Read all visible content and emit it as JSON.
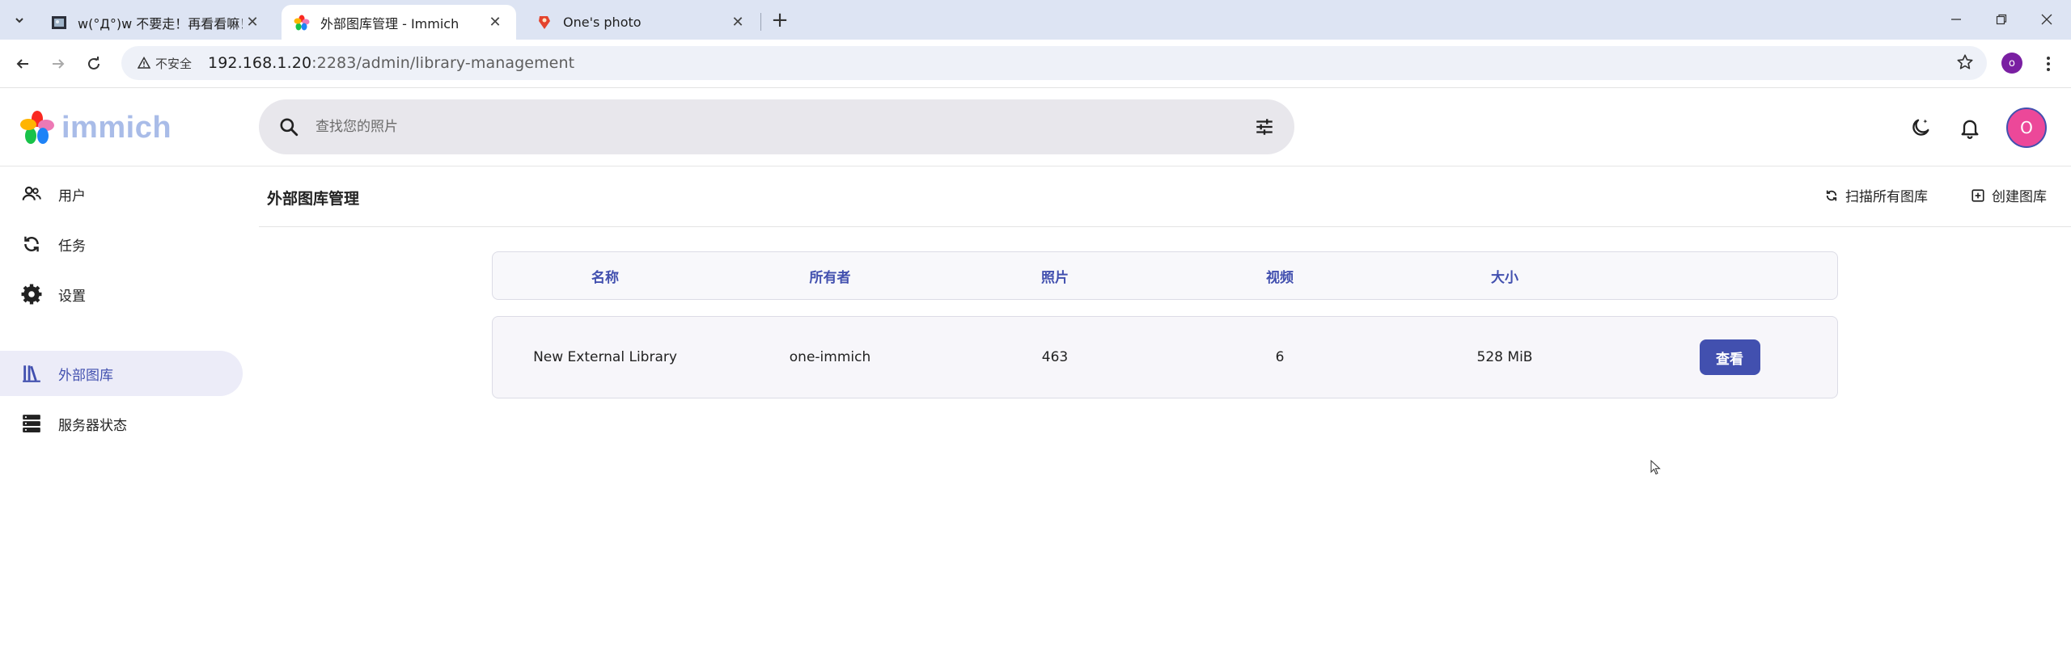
{
  "browser": {
    "tabs": [
      {
        "title": "w(°Д°)w 不要走！再看看嘛！",
        "active": false
      },
      {
        "title": "外部图库管理 - Immich",
        "active": true
      },
      {
        "title": "One's photo",
        "active": false
      }
    ],
    "security_label": "不安全",
    "url_host": "192.168.1.20",
    "url_path": ":2283/admin/library-management",
    "profile_initial": "o"
  },
  "app": {
    "logo_text": "immich",
    "search_placeholder": "查找您的照片",
    "avatar_initial": "O"
  },
  "sidebar": {
    "items": [
      {
        "label": "用户",
        "icon": "users-icon"
      },
      {
        "label": "任务",
        "icon": "sync-icon"
      },
      {
        "label": "设置",
        "icon": "gear-icon"
      },
      {
        "label": "外部图库",
        "icon": "library-icon",
        "active": true
      },
      {
        "label": "服务器状态",
        "icon": "server-icon"
      }
    ]
  },
  "page": {
    "title": "外部图库管理",
    "scan_all_label": "扫描所有图库",
    "create_label": "创建图库"
  },
  "table": {
    "headers": [
      "名称",
      "所有者",
      "照片",
      "视频",
      "大小"
    ],
    "rows": [
      {
        "name": "New External Library",
        "owner": "one-immich",
        "photos": "463",
        "videos": "6",
        "size": "528 MiB",
        "view_label": "查看"
      }
    ]
  },
  "colors": {
    "primary": "#4250af",
    "avatar": "#ec4899",
    "tabstrip": "#dde4f3"
  }
}
